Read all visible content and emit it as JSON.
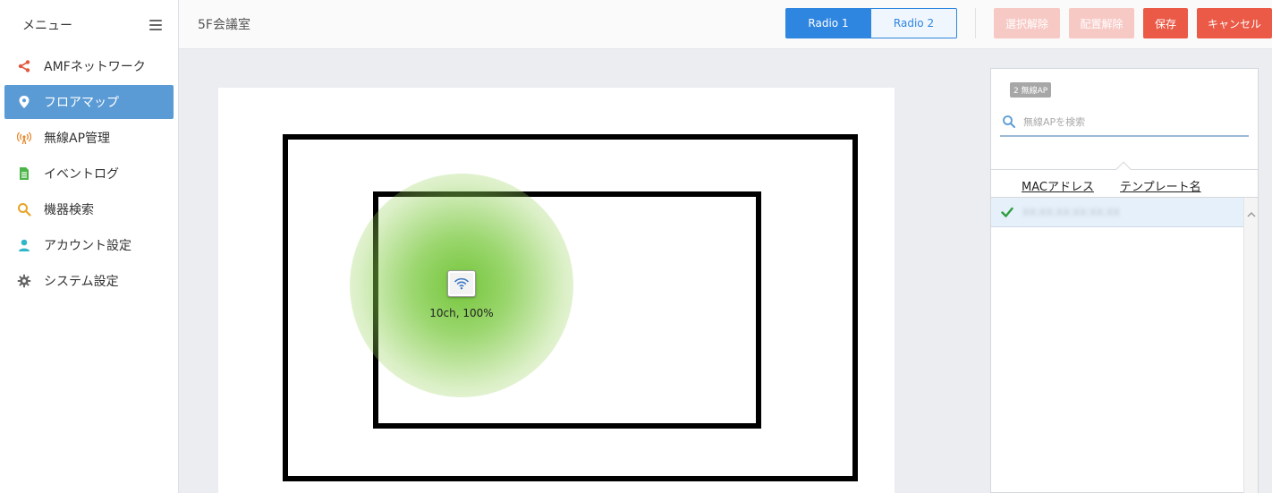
{
  "sidebar": {
    "title": "メニュー",
    "items": [
      {
        "label": "AMFネットワーク",
        "icon": "share-icon"
      },
      {
        "label": "フロアマップ",
        "icon": "map-pin-icon"
      },
      {
        "label": "無線AP管理",
        "icon": "wireless-icon"
      },
      {
        "label": "イベントログ",
        "icon": "document-icon"
      },
      {
        "label": "機器検索",
        "icon": "search-icon"
      },
      {
        "label": "アカウント設定",
        "icon": "user-icon"
      },
      {
        "label": "システム設定",
        "icon": "gear-icon"
      }
    ],
    "active_index": 1
  },
  "header": {
    "page_title": "5F会議室",
    "radio1": "Radio 1",
    "radio2": "Radio 2",
    "selected_radio": "Radio 1",
    "deselect": "選択解除",
    "unplace": "配置解除",
    "save": "保存",
    "cancel": "キャンセル"
  },
  "map": {
    "ap_label": "10ch, 100%"
  },
  "ap_panel": {
    "badge": "2 無線AP",
    "search_placeholder": "無線APを検索",
    "col_mac": "MACアドレス",
    "col_template": "テンプレート名",
    "rows": [
      {
        "mac": "XX:XX:XX:XX:XX:XX",
        "selected": true
      }
    ]
  },
  "colors": {
    "accent": "#2f86e0",
    "active_nav": "#5b9bd5",
    "danger": "#ea5a47",
    "danger_disabled": "#f7c9c5",
    "coverage": "#6ec332"
  }
}
